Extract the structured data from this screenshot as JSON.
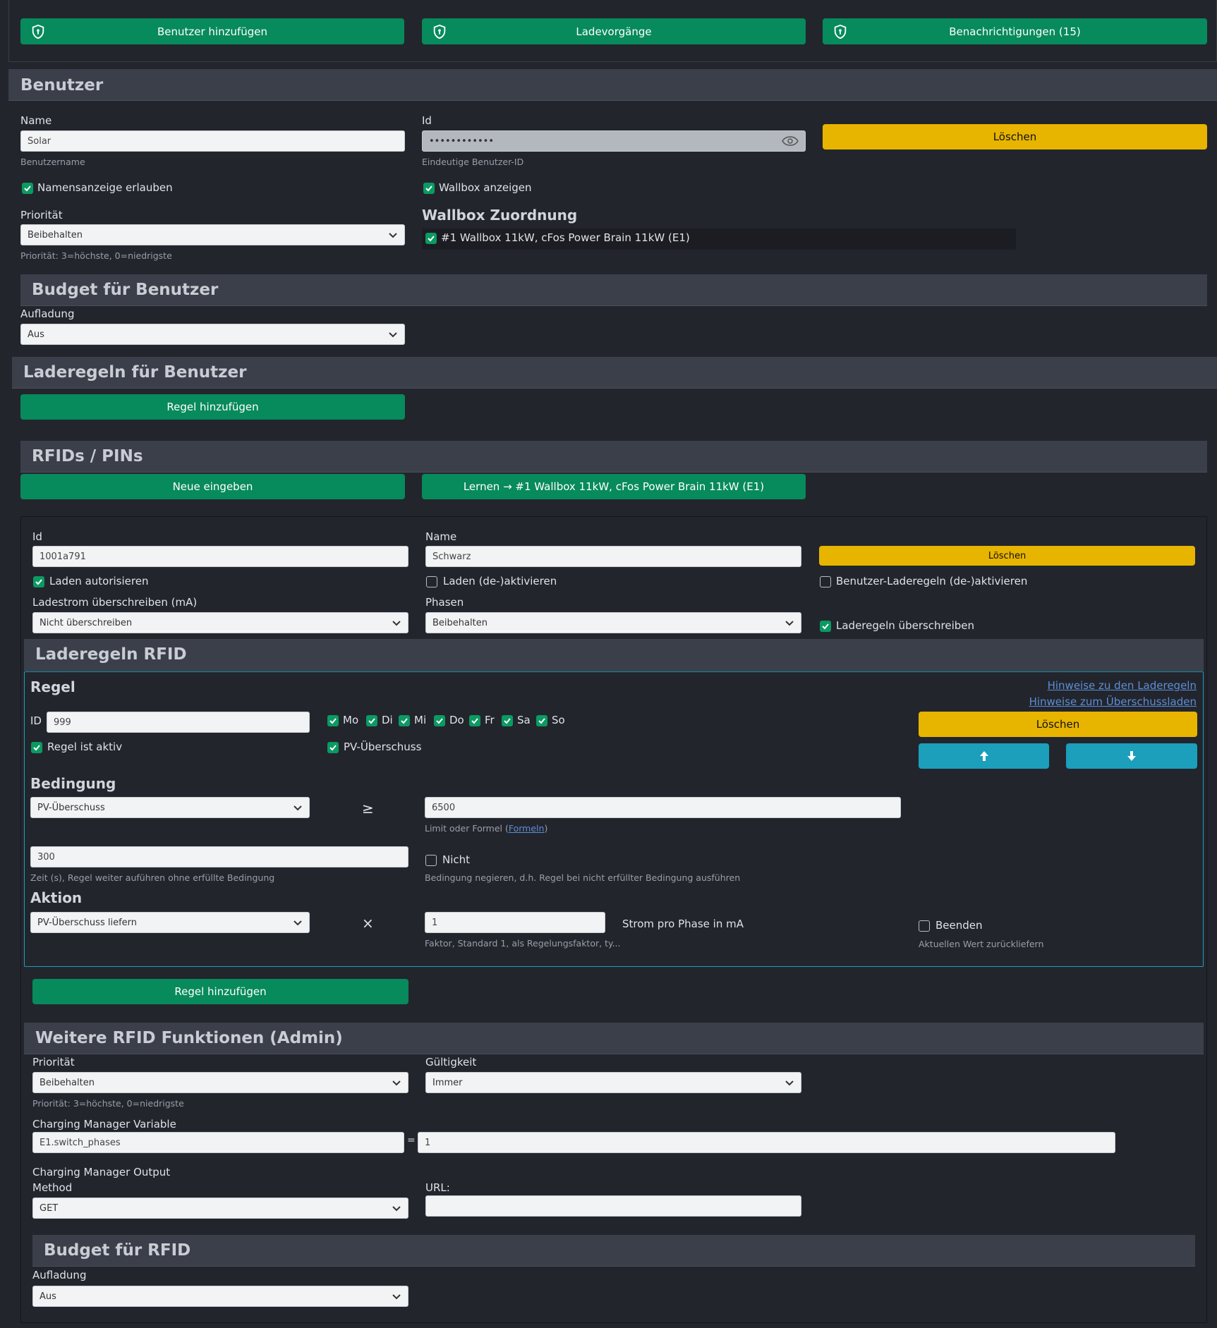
{
  "top_buttons": {
    "add_user": "Benutzer hinzufügen",
    "charging": "Ladevorgänge",
    "notifications": "Benachrichtigungen (15)"
  },
  "user": {
    "header": "Benutzer",
    "name_label": "Name",
    "name_value": "Solar",
    "name_hint": "Benutzername",
    "id_label": "Id",
    "id_value": "••••••••••••",
    "id_hint": "Eindeutige Benutzer-ID",
    "delete": "Löschen",
    "allow_name_display": "Namensanzeige erlauben",
    "show_wallbox": "Wallbox anzeigen",
    "priority_label": "Priorität",
    "priority_value": "Beibehalten",
    "priority_hint": "Priorität: 3=höchste, 0=niedrigste",
    "wallbox_assign_title": "Wallbox Zuordnung",
    "wallbox_assign_item": "#1 Wallbox 11kW, cFos Power Brain 11kW (E1)"
  },
  "budget_user": {
    "header": "Budget für Benutzer",
    "label": "Aufladung",
    "value": "Aus"
  },
  "rules_user": {
    "header": "Laderegeln für Benutzer",
    "add": "Regel hinzufügen"
  },
  "rfids": {
    "header": "RFIDs / PINs",
    "new": "Neue eingeben",
    "learn": "Lernen → #1 Wallbox 11kW, cFos Power Brain 11kW (E1)"
  },
  "rfid_entry": {
    "id_label": "Id",
    "id_value": "1001a791",
    "name_label": "Name",
    "name_value": "Schwarz",
    "delete": "Löschen",
    "authorize": "Laden autorisieren",
    "toggle_charging": "Laden (de-)aktivieren",
    "toggle_user_rules": "Benutzer-Laderegeln (de-)aktivieren",
    "current_label": "Ladestrom überschreiben (mA)",
    "current_value": "Nicht überschreiben",
    "phases_label": "Phasen",
    "phases_value": "Beibehalten",
    "override_rules": "Laderegeln überschreiben"
  },
  "rules_rfid": {
    "header": "Laderegeln RFID",
    "rule_title": "Regel",
    "link_rules": "Hinweise zu den Laderegeln",
    "link_surplus": "Hinweise zum Überschussladen",
    "id_label": "ID",
    "id_value": "999",
    "days": [
      "Mo",
      "Di",
      "Mi",
      "Do",
      "Fr",
      "Sa",
      "So"
    ],
    "delete": "Löschen",
    "rule_active": "Regel ist aktiv",
    "pv_surplus": "PV-Überschuss",
    "condition_title": "Bedingung",
    "condition_value": "PV-Überschuss",
    "operator": "≥",
    "limit_value": "6500",
    "limit_hint_prefix": "Limit oder Formel (",
    "limit_hint_link": "Formeln",
    "limit_hint_suffix": ")",
    "time_value": "300",
    "time_hint": "Zeit (s), Regel weiter auführen ohne erfüllte Bedingung",
    "negate_label": "Nicht",
    "negate_hint": "Bedingung negieren, d.h. Regel bei nicht erfüllter Bedingung ausführen",
    "action_title": "Aktion",
    "action_value": "PV-Überschuss liefern",
    "multiply": "×",
    "factor_value": "1",
    "factor_hint": "Faktor, Standard 1, als Regelungsfaktor, ty...",
    "unit_text": "Strom pro Phase in mA",
    "stop_label": "Beenden",
    "stop_hint": "Aktuellen Wert zurückliefern",
    "add": "Regel hinzufügen"
  },
  "admin": {
    "header": "Weitere RFID Funktionen (Admin)",
    "priority_label": "Priorität",
    "priority_value": "Beibehalten",
    "priority_hint": "Priorität: 3=höchste, 0=niedrigste",
    "validity_label": "Gültigkeit",
    "validity_value": "Immer",
    "cm_var_label": "Charging Manager Variable",
    "cm_var_value": "E1.switch_phases",
    "eq": "=",
    "cm_val_value": "1",
    "cm_output_label": "Charging Manager Output",
    "method_label": "Method",
    "method_value": "GET",
    "url_label": "URL:",
    "url_value": ""
  },
  "budget_rfid": {
    "header": "Budget für RFID",
    "label": "Aufladung",
    "value": "Aus"
  },
  "colors": {
    "green": "#078a5c",
    "yellow": "#e7b400",
    "cyan": "#1b9fbb",
    "background": "#23252d",
    "header": "#3b3f4a"
  }
}
